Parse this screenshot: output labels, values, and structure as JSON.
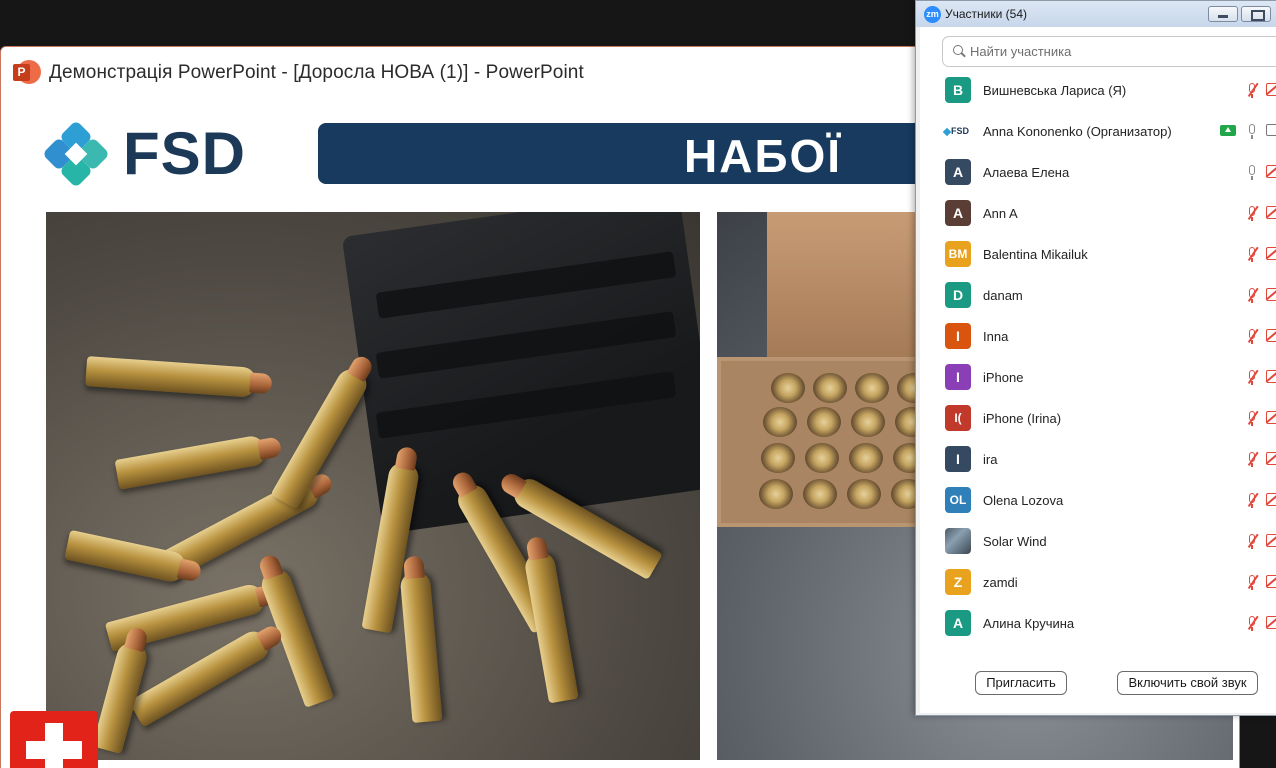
{
  "powerpoint": {
    "window_title": "Демонстрація PowerPoint - [Доросла НОВА (1)] - PowerPoint",
    "app_icon_letter": "P",
    "slide": {
      "logo_text": "FSD",
      "title": "НАБОЇ"
    }
  },
  "zoom": {
    "logo_text": "zm",
    "title": "Участники (54)",
    "search": {
      "placeholder": "Найти участника"
    },
    "participants": [
      {
        "initials": "В",
        "name": "Вишневська Лариса (Я)",
        "color": "#1a9a82",
        "mic": "muted",
        "video": "off"
      },
      {
        "initials": "FSD",
        "name": "Anna Kononenko (Организатор)",
        "color": "#ffffff",
        "mic": "on",
        "video": "on",
        "sharing": true
      },
      {
        "initials": "А",
        "name": "Алаева Елена",
        "color": "#354a60",
        "mic": "on",
        "video": "off"
      },
      {
        "initials": "A",
        "name": "Ann A",
        "color": "#5a3e35",
        "mic": "muted",
        "video": "off"
      },
      {
        "initials": "BM",
        "name": "Balentina Mikailuk",
        "color": "#e8a21d",
        "mic": "muted",
        "video": "off"
      },
      {
        "initials": "D",
        "name": "danam",
        "color": "#1a9a82",
        "mic": "muted",
        "video": "off"
      },
      {
        "initials": "I",
        "name": "Inna",
        "color": "#d9540f",
        "mic": "muted",
        "video": "off"
      },
      {
        "initials": "I",
        "name": "iPhone",
        "color": "#8b3fb6",
        "mic": "muted",
        "video": "off"
      },
      {
        "initials": "I(",
        "name": "iPhone (Irina)",
        "color": "#c0392b",
        "mic": "muted",
        "video": "off"
      },
      {
        "initials": "I",
        "name": "ira",
        "color": "#354a60",
        "mic": "muted",
        "video": "off"
      },
      {
        "initials": "OL",
        "name": "Olena Lozova",
        "color": "#2f7fb8",
        "mic": "muted",
        "video": "off"
      },
      {
        "initials": "",
        "name": "Solar Wind",
        "color": "#5a6672",
        "mic": "muted",
        "video": "off",
        "photo": true
      },
      {
        "initials": "Z",
        "name": "zamdi",
        "color": "#e8a21d",
        "mic": "muted",
        "video": "off"
      },
      {
        "initials": "А",
        "name": "Алина Кручина",
        "color": "#1a9a82",
        "mic": "muted",
        "video": "off"
      }
    ],
    "invite_label": "Пригласить",
    "unmute_label": "Включить свой звук"
  }
}
